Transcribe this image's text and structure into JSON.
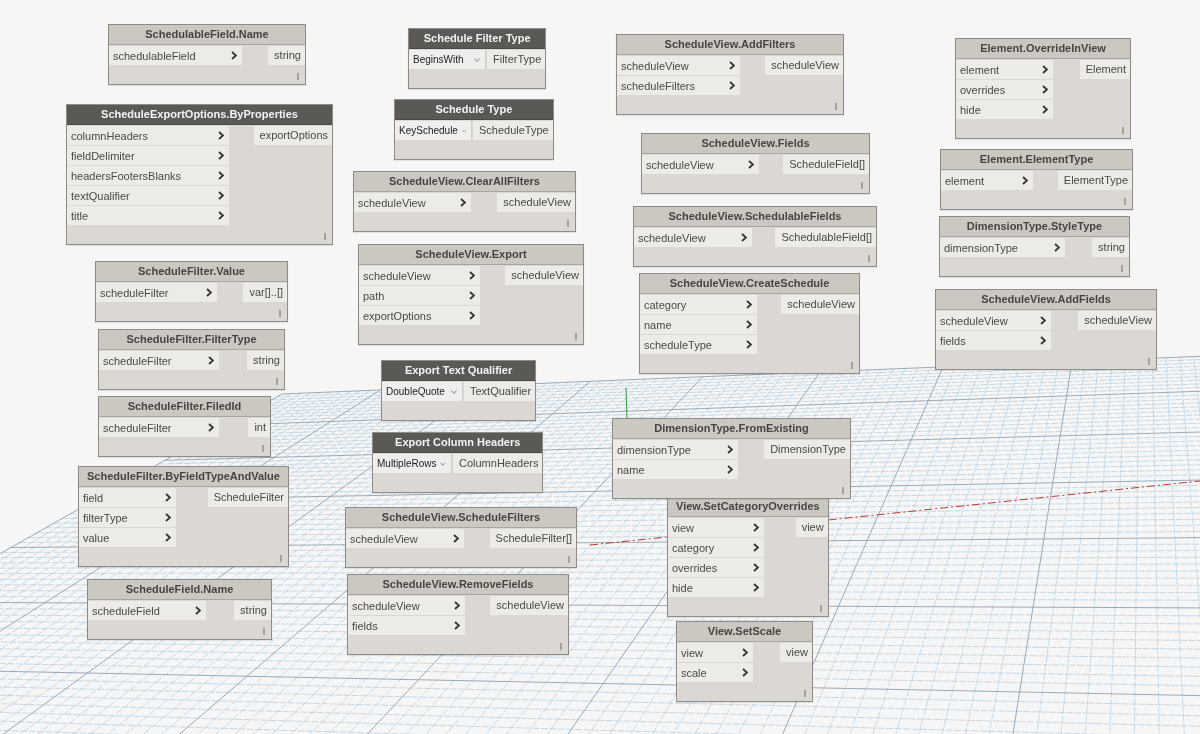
{
  "nodes": [
    {
      "kind": "function",
      "title": "SchedulableField.Name",
      "dark_header": false,
      "inputs": [
        "schedulableField"
      ],
      "outputs": [
        "string"
      ]
    },
    {
      "kind": "function",
      "title": "ScheduleExportOptions.ByProperties",
      "dark_header": true,
      "inputs": [
        "columnHeaders",
        "fieldDelimiter",
        "headersFootersBlanks",
        "textQualifier",
        "title"
      ],
      "outputs": [
        "exportOptions"
      ]
    },
    {
      "kind": "function",
      "title": "ScheduleFilter.Value",
      "dark_header": false,
      "inputs": [
        "scheduleFilter"
      ],
      "outputs": [
        "var[]..[]"
      ]
    },
    {
      "kind": "function",
      "title": "ScheduleFilter.FilterType",
      "dark_header": false,
      "inputs": [
        "scheduleFilter"
      ],
      "outputs": [
        "string"
      ]
    },
    {
      "kind": "function",
      "title": "ScheduleFilter.FiledId",
      "dark_header": false,
      "inputs": [
        "scheduleFilter"
      ],
      "outputs": [
        "int"
      ]
    },
    {
      "kind": "function",
      "title": "ScheduleFilter.ByFieldTypeAndValue",
      "dark_header": false,
      "inputs": [
        "field",
        "filterType",
        "value"
      ],
      "outputs": [
        "ScheduleFilter"
      ]
    },
    {
      "kind": "function",
      "title": "ScheduleField.Name",
      "dark_header": false,
      "inputs": [
        "scheduleField"
      ],
      "outputs": [
        "string"
      ]
    },
    {
      "kind": "selector",
      "title": "Schedule Filter Type",
      "dark_header": true,
      "value": "BeginsWith",
      "outputs": [
        "FilterType"
      ]
    },
    {
      "kind": "selector",
      "title": "Schedule Type",
      "dark_header": true,
      "value": "KeySchedule",
      "outputs": [
        "ScheduleType"
      ]
    },
    {
      "kind": "function",
      "title": "ScheduleView.ClearAllFilters",
      "dark_header": false,
      "inputs": [
        "scheduleView"
      ],
      "outputs": [
        "scheduleView"
      ]
    },
    {
      "kind": "function",
      "title": "ScheduleView.Export",
      "dark_header": false,
      "inputs": [
        "scheduleView",
        "path",
        "exportOptions"
      ],
      "outputs": [
        "scheduleView"
      ]
    },
    {
      "kind": "selector",
      "title": "Export Text Qualifier",
      "dark_header": true,
      "value": "DoubleQuote",
      "outputs": [
        "TextQualifier"
      ]
    },
    {
      "kind": "selector",
      "title": "Export Column Headers",
      "dark_header": true,
      "value": "MultipleRows",
      "outputs": [
        "ColumnHeaders"
      ]
    },
    {
      "kind": "function",
      "title": "ScheduleView.ScheduleFilters",
      "dark_header": false,
      "inputs": [
        "scheduleView"
      ],
      "outputs": [
        "ScheduleFilter[]"
      ]
    },
    {
      "kind": "function",
      "title": "ScheduleView.RemoveFields",
      "dark_header": false,
      "inputs": [
        "scheduleView",
        "fields"
      ],
      "outputs": [
        "scheduleView"
      ]
    },
    {
      "kind": "function",
      "title": "ScheduleView.AddFilters",
      "dark_header": false,
      "inputs": [
        "scheduleView",
        "scheduleFilters"
      ],
      "outputs": [
        "scheduleView"
      ]
    },
    {
      "kind": "function",
      "title": "ScheduleView.Fields",
      "dark_header": false,
      "inputs": [
        "scheduleView"
      ],
      "outputs": [
        "ScheduleField[]"
      ]
    },
    {
      "kind": "function",
      "title": "ScheduleView.SchedulableFields",
      "dark_header": false,
      "inputs": [
        "scheduleView"
      ],
      "outputs": [
        "SchedulableField[]"
      ]
    },
    {
      "kind": "function",
      "title": "ScheduleView.CreateSchedule",
      "dark_header": false,
      "inputs": [
        "category",
        "name",
        "scheduleType"
      ],
      "outputs": [
        "scheduleView"
      ]
    },
    {
      "kind": "function",
      "title": "DimensionType.FromExisting",
      "dark_header": false,
      "inputs": [
        "dimensionType",
        "name"
      ],
      "outputs": [
        "DimensionType"
      ]
    },
    {
      "kind": "function",
      "title": "View.SetCategoryOverrides",
      "dark_header": false,
      "inputs": [
        "view",
        "category",
        "overrides",
        "hide"
      ],
      "outputs": [
        "view"
      ]
    },
    {
      "kind": "function",
      "title": "View.SetScale",
      "dark_header": false,
      "inputs": [
        "view",
        "scale"
      ],
      "outputs": [
        "view"
      ]
    },
    {
      "kind": "function",
      "title": "Element.OverrideInView",
      "dark_header": false,
      "inputs": [
        "element",
        "overrides",
        "hide"
      ],
      "outputs": [
        "Element"
      ]
    },
    {
      "kind": "function",
      "title": "Element.ElementType",
      "dark_header": false,
      "inputs": [
        "element"
      ],
      "outputs": [
        "ElementType"
      ]
    },
    {
      "kind": "function",
      "title": "DimensionType.StyleType",
      "dark_header": false,
      "inputs": [
        "dimensionType"
      ],
      "outputs": [
        "string"
      ]
    },
    {
      "kind": "function",
      "title": "ScheduleView.AddFields",
      "dark_header": false,
      "inputs": [
        "scheduleView",
        "fields"
      ],
      "outputs": [
        "scheduleView"
      ]
    }
  ]
}
